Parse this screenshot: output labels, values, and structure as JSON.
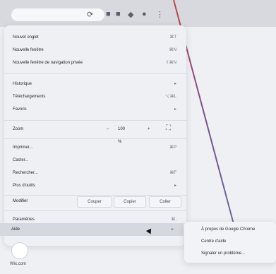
{
  "menu": {
    "items": [
      {
        "label": "Nouvel onglet",
        "shortcut": "⌘T"
      },
      {
        "label": "Nouvelle fenêtre",
        "shortcut": "⌘N"
      },
      {
        "label": "Nouvelle fenêtre de navigation privée",
        "shortcut": "⇧⌘N"
      },
      {
        "label": "Historique",
        "shortcut": "▸"
      },
      {
        "label": "Téléchargements",
        "shortcut": "⌥⌘L"
      },
      {
        "label": "Favoris",
        "shortcut": "▸"
      },
      {
        "label": "Zoom",
        "shortcut": ""
      },
      {
        "label": "Imprimer...",
        "shortcut": "⌘P"
      },
      {
        "label": "Caster...",
        "shortcut": ""
      },
      {
        "label": "Rechercher...",
        "shortcut": "⌘F"
      },
      {
        "label": "Plus d'outils",
        "shortcut": "▸"
      },
      {
        "label": "Paramètres",
        "shortcut": "⌘,"
      },
      {
        "label": "Aide",
        "shortcut": "▸"
      }
    ],
    "zoom": {
      "minus": "–",
      "value": "100 %",
      "plus": "+"
    },
    "edit": {
      "label": "Modifier",
      "cut": "Couper",
      "copy": "Copier",
      "paste": "Coller"
    }
  },
  "submenu": {
    "items": [
      "À propos de Google Chrome",
      "Centre d'aide",
      "Signaler un problème..."
    ]
  },
  "footer": {
    "label": "Wix.com"
  }
}
